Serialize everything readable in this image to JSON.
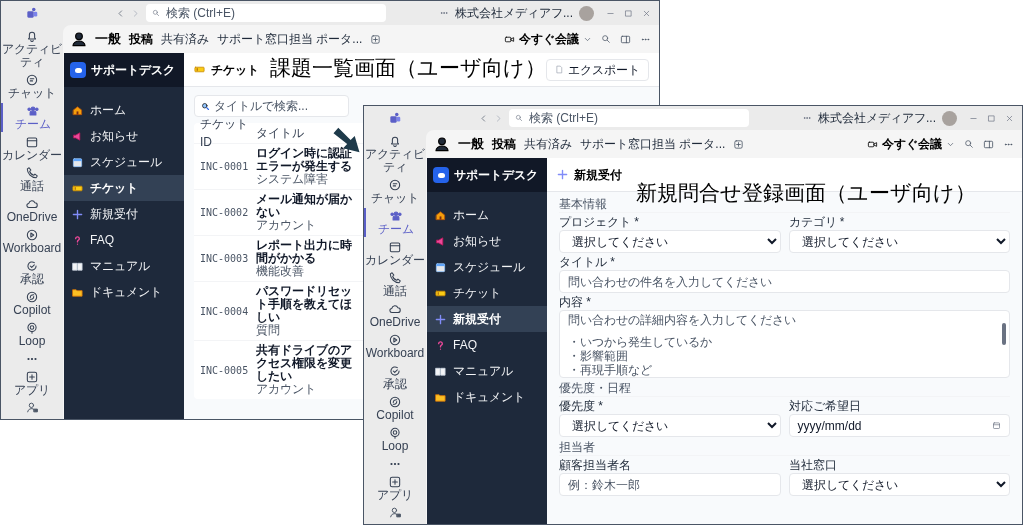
{
  "windows": [
    {
      "search_placeholder": "検索 (Ctrl+E)",
      "account": "株式会社メディアフ...",
      "rail": [
        {
          "label": "アクティビティ",
          "selected": false
        },
        {
          "label": "チャット",
          "selected": false
        },
        {
          "label": "チーム",
          "selected": true
        },
        {
          "label": "カレンダー",
          "selected": false
        },
        {
          "label": "通話",
          "selected": false
        },
        {
          "label": "OneDrive",
          "selected": false
        },
        {
          "label": "Workboard",
          "selected": false
        },
        {
          "label": "承認",
          "selected": false
        },
        {
          "label": "Copilot",
          "selected": false
        },
        {
          "label": "Loop",
          "selected": false
        },
        {
          "selected": false
        },
        {
          "label": "アプリ",
          "selected": false
        }
      ],
      "channel": {
        "name": "一般",
        "tabs": [
          {
            "label": "投稿",
            "selected": true
          },
          {
            "label": "共有済み",
            "selected": false
          },
          {
            "label": "サポート窓口担当 ポータ...",
            "selected": false
          }
        ],
        "meet_button": "今すぐ会議"
      },
      "app": {
        "title": "サポートデスク",
        "nav": [
          {
            "label": "ホーム",
            "selected": false
          },
          {
            "label": "お知らせ",
            "selected": false
          },
          {
            "label": "スケジュール",
            "selected": false
          },
          {
            "label": "チケット",
            "selected": true
          },
          {
            "label": "新規受付",
            "selected": false
          },
          {
            "label": "FAQ",
            "selected": false
          },
          {
            "label": "マニュアル",
            "selected": false
          },
          {
            "label": "ドキュメント",
            "selected": false
          }
        ]
      },
      "page": {
        "kind": "ticket_list",
        "title": "チケット",
        "export_button": "エクスポート",
        "search_placeholder": "タイトルで検索...",
        "columns": [
          "チケットID",
          "タイトル"
        ],
        "rows": [
          {
            "id": "INC-0001",
            "title": "ログイン時に認証エラーが発生する",
            "category": "システム障害"
          },
          {
            "id": "INC-0002",
            "title": "メール通知が届かない",
            "category": "アカウント"
          },
          {
            "id": "INC-0003",
            "title": "レポート出力に時間がかかる",
            "category": "機能改善"
          },
          {
            "id": "INC-0004",
            "title": "パスワードリセット手順を教えてほしい",
            "category": "質問"
          },
          {
            "id": "INC-0005",
            "title": "共有ドライブのアクセス権限を変更したい",
            "category": "アカウント"
          }
        ]
      }
    },
    {
      "search_placeholder": "検索 (Ctrl+E)",
      "account": "株式会社メディアフ...",
      "rail": [
        {
          "label": "アクティビティ",
          "selected": false
        },
        {
          "label": "チャット",
          "selected": false
        },
        {
          "label": "チーム",
          "selected": true
        },
        {
          "label": "カレンダー",
          "selected": false
        },
        {
          "label": "通話",
          "selected": false
        },
        {
          "label": "OneDrive",
          "selected": false
        },
        {
          "label": "Workboard",
          "selected": false
        },
        {
          "label": "承認",
          "selected": false
        },
        {
          "label": "Copilot",
          "selected": false
        },
        {
          "label": "Loop",
          "selected": false
        },
        {
          "selected": false
        },
        {
          "label": "アプリ",
          "selected": false
        }
      ],
      "channel": {
        "name": "一般",
        "tabs": [
          {
            "label": "投稿",
            "selected": true
          },
          {
            "label": "共有済み",
            "selected": false
          },
          {
            "label": "サポート窓口担当 ポータ...",
            "selected": false
          }
        ],
        "meet_button": "今すぐ会議"
      },
      "app": {
        "title": "サポートデスク",
        "nav": [
          {
            "label": "ホーム",
            "selected": false
          },
          {
            "label": "お知らせ",
            "selected": false
          },
          {
            "label": "スケジュール",
            "selected": false
          },
          {
            "label": "チケット",
            "selected": false
          },
          {
            "label": "新規受付",
            "selected": true
          },
          {
            "label": "FAQ",
            "selected": false
          },
          {
            "label": "マニュアル",
            "selected": false
          },
          {
            "label": "ドキュメント",
            "selected": false
          }
        ]
      },
      "page": {
        "kind": "form",
        "title": "新規受付",
        "sections": [
          {
            "heading": "基本情報",
            "rows": [
              [
                {
                  "kind": "select",
                  "label": "プロジェクト *",
                  "value": "選択してください"
                },
                {
                  "kind": "select",
                  "label": "カテゴリ *",
                  "value": "選択してください"
                }
              ],
              [
                {
                  "kind": "text",
                  "label": "タイトル *",
                  "placeholder": "問い合わせの件名を入力してください"
                }
              ],
              [
                {
                  "kind": "textarea",
                  "label": "内容 *",
                  "placeholder_lines": [
                    "問い合わせの詳細内容を入力してください",
                    "・いつから発生しているか",
                    "・影響範囲",
                    "・再現手順など"
                  ]
                }
              ]
            ]
          },
          {
            "heading": "優先度・日程",
            "rows": [
              [
                {
                  "kind": "select",
                  "label": "優先度 *",
                  "value": "選択してください"
                },
                {
                  "kind": "date",
                  "label": "対応ご希望日",
                  "placeholder": "yyyy/mm/dd"
                }
              ]
            ]
          },
          {
            "heading": "担当者",
            "rows": [
              [
                {
                  "kind": "text",
                  "label": "顧客担当者名",
                  "placeholder": "例：鈴木一郎"
                },
                {
                  "kind": "select",
                  "label": "当社窓口",
                  "value": "選択してください"
                }
              ]
            ]
          }
        ]
      }
    }
  ],
  "captions": [
    "課題一覧画面（ユーザ向け）",
    "新規問合せ登録画面（ユーザ向け）"
  ]
}
